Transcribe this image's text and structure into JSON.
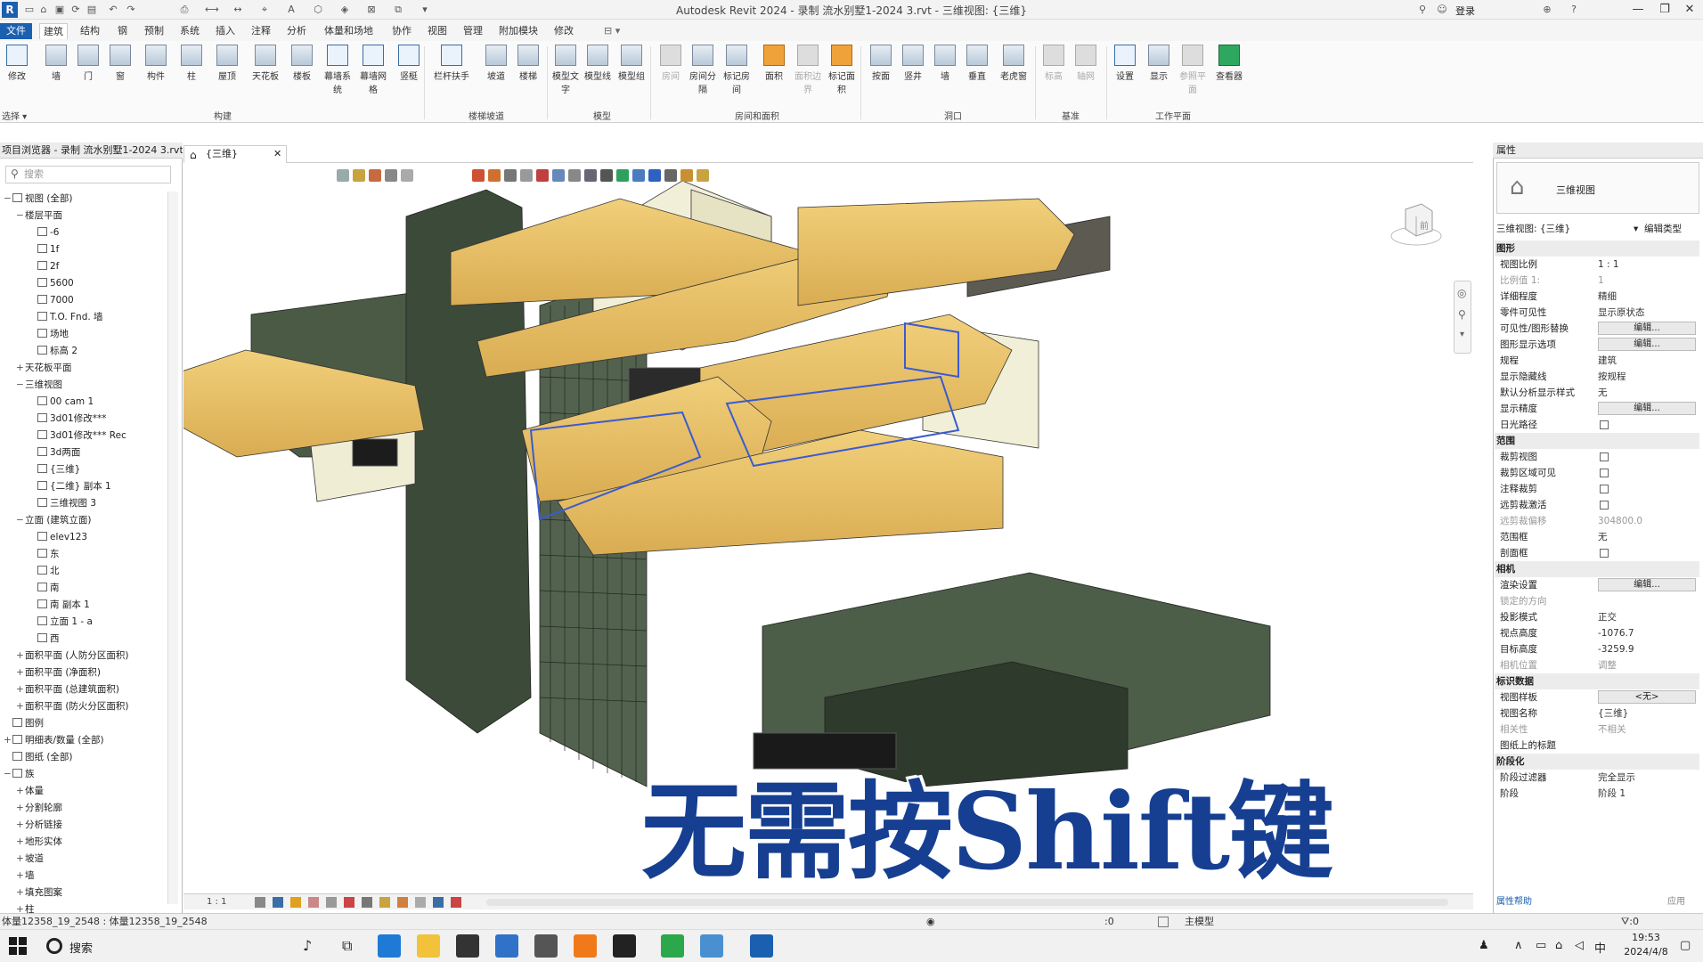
{
  "app": {
    "logo": "R",
    "title": "Autodesk Revit 2024 - 录制 流水别墅1-2024 3.rvt - 三维视图: {三维}",
    "user": "登录"
  },
  "tabs": [
    "文件",
    "建筑",
    "结构",
    "钢",
    "预制",
    "系统",
    "插入",
    "注释",
    "分析",
    "体量和场地",
    "协作",
    "视图",
    "管理",
    "附加模块",
    "修改"
  ],
  "ribbon": {
    "select_label": "选择",
    "buttons": [
      {
        "label": "修改"
      },
      {
        "label": "墙"
      },
      {
        "label": "门"
      },
      {
        "label": "窗"
      },
      {
        "label": "构件"
      },
      {
        "label": "柱"
      },
      {
        "label": "屋顶"
      },
      {
        "label": "天花板"
      },
      {
        "label": "楼板"
      },
      {
        "label": "幕墙系统"
      },
      {
        "label": "幕墙网格"
      },
      {
        "label": "竖梃"
      },
      {
        "label": "栏杆扶手"
      },
      {
        "label": "坡道"
      },
      {
        "label": "楼梯"
      },
      {
        "label": "模型文字"
      },
      {
        "label": "模型线"
      },
      {
        "label": "模型组"
      },
      {
        "label": "房间"
      },
      {
        "label": "房间分隔"
      },
      {
        "label": "标记房间"
      },
      {
        "label": "面积"
      },
      {
        "label": "面积边界"
      },
      {
        "label": "标记面积"
      },
      {
        "label": "按面"
      },
      {
        "label": "竖井"
      },
      {
        "label": "墙"
      },
      {
        "label": "垂直"
      },
      {
        "label": "老虎窗"
      },
      {
        "label": "标高"
      },
      {
        "label": "轴网"
      },
      {
        "label": "设置"
      },
      {
        "label": "显示"
      },
      {
        "label": "参照平面"
      },
      {
        "label": "查看器"
      }
    ],
    "panels": [
      "构建",
      "楼梯坡道",
      "模型",
      "房间和面积",
      "洞口",
      "基准",
      "工作平面"
    ]
  },
  "project_browser": {
    "title": "项目浏览器 - 录制 流水别墅1-2024 3.rvt",
    "search_placeholder": "搜索",
    "items": [
      {
        "label": "视图 (全部)",
        "level": 0,
        "toggle": "−",
        "box": true
      },
      {
        "label": "楼层平面",
        "level": 1,
        "toggle": "−",
        "box": false
      },
      {
        "label": "-6",
        "level": 2,
        "toggle": "",
        "box": true
      },
      {
        "label": "1f",
        "level": 2,
        "toggle": "",
        "box": true
      },
      {
        "label": "2f",
        "level": 2,
        "toggle": "",
        "box": true
      },
      {
        "label": "5600",
        "level": 2,
        "toggle": "",
        "box": true
      },
      {
        "label": "7000",
        "level": 2,
        "toggle": "",
        "box": true
      },
      {
        "label": "T.O. Fnd. 墙",
        "level": 2,
        "toggle": "",
        "box": true
      },
      {
        "label": "场地",
        "level": 2,
        "toggle": "",
        "box": true
      },
      {
        "label": "标高 2",
        "level": 2,
        "toggle": "",
        "box": true
      },
      {
        "label": "天花板平面",
        "level": 1,
        "toggle": "+",
        "box": false
      },
      {
        "label": "三维视图",
        "level": 1,
        "toggle": "−",
        "box": false
      },
      {
        "label": "00 cam 1",
        "level": 2,
        "toggle": "",
        "box": true
      },
      {
        "label": "3d01修改***",
        "level": 2,
        "toggle": "",
        "box": true
      },
      {
        "label": "3d01修改*** Rec",
        "level": 2,
        "toggle": "",
        "box": true
      },
      {
        "label": "3d两面",
        "level": 2,
        "toggle": "",
        "box": true
      },
      {
        "label": "{三维}",
        "level": 2,
        "toggle": "",
        "box": true
      },
      {
        "label": "{二维} 副本 1",
        "level": 2,
        "toggle": "",
        "box": true
      },
      {
        "label": "三维视图 3",
        "level": 2,
        "toggle": "",
        "box": true
      },
      {
        "label": "立面 (建筑立面)",
        "level": 1,
        "toggle": "−",
        "box": false
      },
      {
        "label": "elev123",
        "level": 2,
        "toggle": "",
        "box": true
      },
      {
        "label": "东",
        "level": 2,
        "toggle": "",
        "box": true
      },
      {
        "label": "北",
        "level": 2,
        "toggle": "",
        "box": true
      },
      {
        "label": "南",
        "level": 2,
        "toggle": "",
        "box": true
      },
      {
        "label": "南 副本 1",
        "level": 2,
        "toggle": "",
        "box": true
      },
      {
        "label": "立面 1 - a",
        "level": 2,
        "toggle": "",
        "box": true
      },
      {
        "label": "西",
        "level": 2,
        "toggle": "",
        "box": true
      },
      {
        "label": "面积平面 (人防分区面积)",
        "level": 1,
        "toggle": "+",
        "box": false
      },
      {
        "label": "面积平面 (净面积)",
        "level": 1,
        "toggle": "+",
        "box": false
      },
      {
        "label": "面积平面 (总建筑面积)",
        "level": 1,
        "toggle": "+",
        "box": false
      },
      {
        "label": "面积平面 (防火分区面积)",
        "level": 1,
        "toggle": "+",
        "box": false
      },
      {
        "label": "图例",
        "level": 0,
        "toggle": "",
        "box": true
      },
      {
        "label": "明细表/数量 (全部)",
        "level": 0,
        "toggle": "+",
        "box": true
      },
      {
        "label": "图纸 (全部)",
        "level": 0,
        "toggle": "",
        "box": true
      },
      {
        "label": "族",
        "level": 0,
        "toggle": "−",
        "box": true
      },
      {
        "label": "体量",
        "level": 1,
        "toggle": "+",
        "box": false
      },
      {
        "label": "分割轮廓",
        "level": 1,
        "toggle": "+",
        "box": false
      },
      {
        "label": "分析链接",
        "level": 1,
        "toggle": "+",
        "box": false
      },
      {
        "label": "地形实体",
        "level": 1,
        "toggle": "+",
        "box": false
      },
      {
        "label": "坡道",
        "level": 1,
        "toggle": "+",
        "box": false
      },
      {
        "label": "墙",
        "level": 1,
        "toggle": "+",
        "box": false
      },
      {
        "label": "填充图案",
        "level": 1,
        "toggle": "+",
        "box": false
      },
      {
        "label": "柱",
        "level": 1,
        "toggle": "+",
        "box": false
      }
    ]
  },
  "view": {
    "tab_label": "{三维}",
    "cube_label": "前",
    "scale": "1 : 1"
  },
  "properties": {
    "title": "属性",
    "type_name": "三维视图",
    "selector": "三维视图: {三维}",
    "edit_type": "编辑类型",
    "rows": [
      {
        "kind": "cat",
        "k": "图形"
      },
      {
        "kind": "val",
        "k": "视图比例",
        "v": "1 : 1"
      },
      {
        "kind": "gray",
        "k": "比例值 1:",
        "v": "1"
      },
      {
        "kind": "val",
        "k": "详细程度",
        "v": "精细"
      },
      {
        "kind": "val",
        "k": "零件可见性",
        "v": "显示原状态"
      },
      {
        "kind": "btn",
        "k": "可见性/图形替换",
        "v": "编辑..."
      },
      {
        "kind": "btn",
        "k": "图形显示选项",
        "v": "编辑..."
      },
      {
        "kind": "val",
        "k": "规程",
        "v": "建筑"
      },
      {
        "kind": "val",
        "k": "显示隐藏线",
        "v": "按规程"
      },
      {
        "kind": "val",
        "k": "默认分析显示样式",
        "v": "无"
      },
      {
        "kind": "btn",
        "k": "显示精度",
        "v": "编辑..."
      },
      {
        "kind": "cb",
        "k": "日光路径",
        "v": ""
      },
      {
        "kind": "cat",
        "k": "范围"
      },
      {
        "kind": "cb",
        "k": "裁剪视图",
        "v": ""
      },
      {
        "kind": "cb",
        "k": "裁剪区域可见",
        "v": ""
      },
      {
        "kind": "cb",
        "k": "注释裁剪",
        "v": ""
      },
      {
        "kind": "cb",
        "k": "远剪裁激活",
        "v": ""
      },
      {
        "kind": "gray",
        "k": "远剪裁偏移",
        "v": "304800.0"
      },
      {
        "kind": "val",
        "k": "范围框",
        "v": "无"
      },
      {
        "kind": "cb",
        "k": "剖面框",
        "v": ""
      },
      {
        "kind": "cat",
        "k": "相机"
      },
      {
        "kind": "btn",
        "k": "渲染设置",
        "v": "编辑..."
      },
      {
        "kind": "gray",
        "k": "锁定的方向",
        "v": ""
      },
      {
        "kind": "val",
        "k": "投影模式",
        "v": "正交"
      },
      {
        "kind": "val",
        "k": "视点高度",
        "v": "-1076.7"
      },
      {
        "kind": "val",
        "k": "目标高度",
        "v": "-3259.9"
      },
      {
        "kind": "gray",
        "k": "相机位置",
        "v": "调整"
      },
      {
        "kind": "cat",
        "k": "标识数据"
      },
      {
        "kind": "btn",
        "k": "视图样板",
        "v": "<无>"
      },
      {
        "kind": "val",
        "k": "视图名称",
        "v": "{三维}"
      },
      {
        "kind": "gray",
        "k": "相关性",
        "v": "不相关"
      },
      {
        "kind": "val",
        "k": "图纸上的标题",
        "v": ""
      },
      {
        "kind": "cat",
        "k": "阶段化"
      },
      {
        "kind": "val",
        "k": "阶段过滤器",
        "v": "完全显示"
      },
      {
        "kind": "val",
        "k": "阶段",
        "v": "阶段 1"
      }
    ],
    "help_link": "属性帮助",
    "apply": "应用"
  },
  "status": {
    "text": "体量12358_19_2548 : 体量12358_19_2548",
    "model": "主模型",
    "zero": ":0"
  },
  "taskbar": {
    "search": "搜索",
    "time": "19:53",
    "date": "2024/4/8",
    "ime": "中"
  },
  "overlay": {
    "text": "无需按Shift键"
  }
}
